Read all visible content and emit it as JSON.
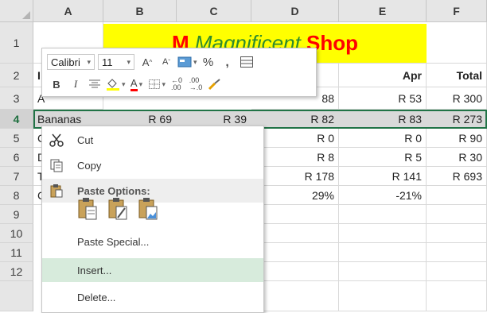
{
  "columns": [
    "A",
    "B",
    "C",
    "D",
    "E",
    "F"
  ],
  "rows": [
    "1",
    "2",
    "3",
    "4",
    "5",
    "6",
    "7",
    "8",
    "9",
    "10",
    "11",
    "12"
  ],
  "title": {
    "part1": "M",
    "part2": "Magnificent",
    "part3": "Shop"
  },
  "headers": {
    "apr": "Apr",
    "total": "Total"
  },
  "cells": {
    "r3": {
      "a": "A",
      "d": "88",
      "e": "R 53",
      "f": "R 300"
    },
    "r4": {
      "a": "Bananas",
      "b": "R 69",
      "c": "R 39",
      "d": "R 82",
      "e": "R 83",
      "f": "R 273"
    },
    "r5": {
      "a": "C",
      "d": "R 0",
      "e": "R 0",
      "f": "R 90"
    },
    "r6": {
      "a": "D",
      "d": "R 8",
      "e": "R 5",
      "f": "R 30"
    },
    "r7": {
      "a": "T",
      "d": "R 178",
      "e": "R 141",
      "f": "R 693"
    },
    "r8": {
      "a": "C",
      "d": "29%",
      "e": "-21%"
    },
    "r2": {
      "a": "I"
    }
  },
  "mini_toolbar": {
    "font_name": "Calibri",
    "font_size": "11",
    "percent": "%",
    "comma": ",",
    "bold": "B",
    "italic": "I",
    "font_color": "A",
    "grow": "A",
    "shrink": "A"
  },
  "context_menu": {
    "cut": "Cut",
    "copy": "Copy",
    "paste_options": "Paste Options:",
    "paste_special": "Paste Special...",
    "insert": "Insert...",
    "delete": "Delete..."
  },
  "colors": {
    "selection": "#217346",
    "title_fill": "#ffff00",
    "title_red": "#ff0000",
    "title_green": "#2e8b2e",
    "menu_highlight": "#d7ebdc"
  }
}
